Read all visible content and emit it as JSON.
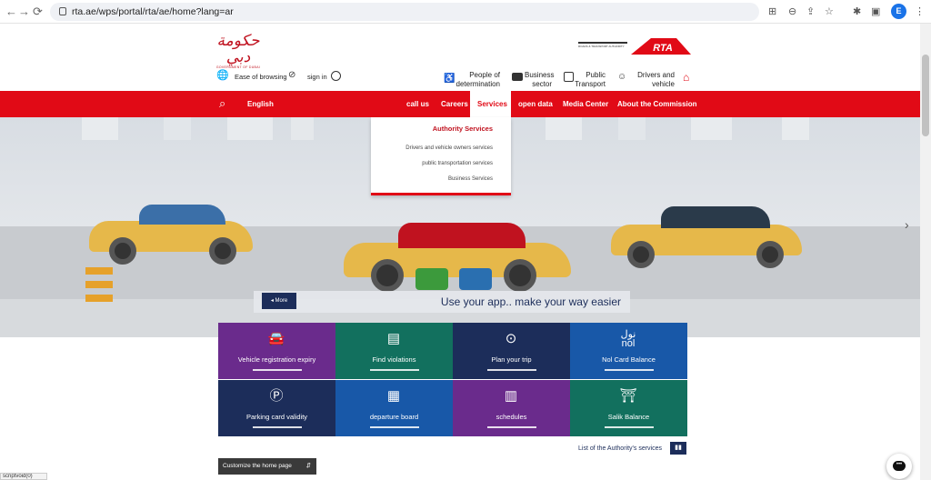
{
  "browser": {
    "url": "rta.ae/wps/portal/rta/ae/home?lang=ar",
    "profile_initial": "E",
    "status_url": "scriptvoid(0)"
  },
  "header": {
    "gov_logo_ar": "حكومة دبي",
    "gov_logo_en": "GOVERNMENT OF DUBAI",
    "rta_logo": "RTA",
    "rta_sub": "ROADS & TRANSPORT AUTHORITY",
    "ease_of_browsing": "Ease of browsing",
    "sign_in": "sign in",
    "top_links": [
      {
        "label": "People of determination"
      },
      {
        "label": "Business sector"
      },
      {
        "label": "Public Transport"
      },
      {
        "label": "Drivers and vehicle owners"
      }
    ]
  },
  "main_nav": {
    "language": "English",
    "items": [
      "call us",
      "Careers",
      "Services",
      "open data",
      "Media Center",
      "About the Commission"
    ],
    "active": "Services"
  },
  "services_dropdown": {
    "title": "Authority Services",
    "items": [
      "Drivers and vehicle owners services",
      "public transportation services",
      "Business Services"
    ]
  },
  "hero": {
    "more_label": "More",
    "slogan": "Use your app.. make your way easier"
  },
  "tiles": [
    {
      "label": "Vehicle registration expiry",
      "icon": "car-icon",
      "color": "#6a2b8c"
    },
    {
      "label": "Find violations",
      "icon": "violation-icon",
      "color": "#12705e"
    },
    {
      "label": "Plan your trip",
      "icon": "map-pin-icon",
      "color": "#1c2d5a"
    },
    {
      "label": "Nol Card Balance",
      "icon": "nol-icon",
      "color": "#1858a8"
    },
    {
      "label": "Parking card validity",
      "icon": "parking-icon",
      "color": "#1c2d5a"
    },
    {
      "label": "departure board",
      "icon": "bus-icon",
      "color": "#1858a8"
    },
    {
      "label": "schedules",
      "icon": "schedule-icon",
      "color": "#6a2b8c"
    },
    {
      "label": "Salik Balance",
      "icon": "salik-icon",
      "color": "#12705e"
    }
  ],
  "footer": {
    "list_services": "List of the Authority's services",
    "customize": "Customize the home page"
  },
  "colors": {
    "brand_red": "#e10a16",
    "navy": "#1c2d5a"
  }
}
